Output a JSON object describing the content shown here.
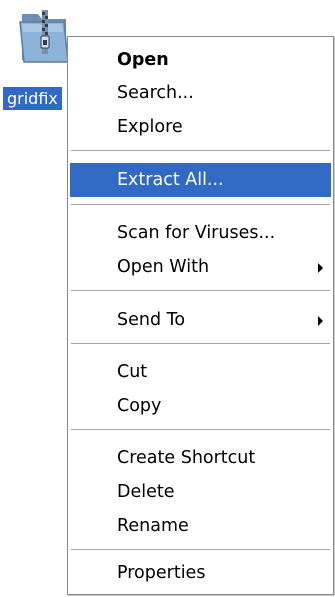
{
  "desktop_icon": {
    "label": "gridfix",
    "icon": "zip-folder-icon"
  },
  "context_menu": {
    "items": [
      {
        "label": "Open",
        "bold": true
      },
      {
        "label": "Search..."
      },
      {
        "label": "Explore"
      },
      {
        "label": "Extract All...",
        "selected": true
      },
      {
        "label": "Scan for Viruses..."
      },
      {
        "label": "Open With",
        "submenu": true
      },
      {
        "label": "Send To",
        "submenu": true
      },
      {
        "label": "Cut"
      },
      {
        "label": "Copy"
      },
      {
        "label": "Create Shortcut"
      },
      {
        "label": "Delete"
      },
      {
        "label": "Rename"
      },
      {
        "label": "Properties"
      }
    ]
  },
  "colors": {
    "selection": "#316ac5",
    "separator": "#a6a6a6",
    "folder": "#8cb4d8"
  }
}
